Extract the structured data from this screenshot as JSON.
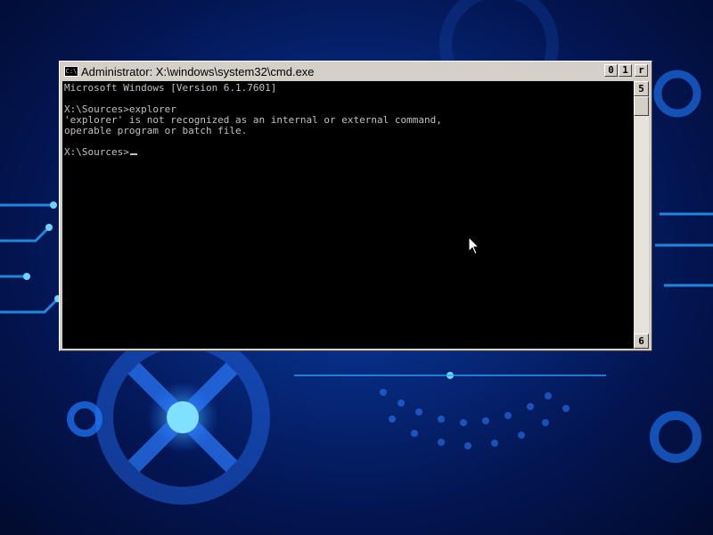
{
  "window": {
    "title": "Administrator: X:\\windows\\system32\\cmd.exe",
    "icon": "cmd-icon",
    "icon_text": "C:\\",
    "buttons": {
      "minimize": "0",
      "maximize": "1",
      "close": "r"
    }
  },
  "console": {
    "text": "Microsoft Windows [Version 6.1.7601]\n\nX:\\Sources>explorer\n'explorer' is not recognized as an internal or external command,\noperable program or batch file.\n\nX:\\Sources>"
  },
  "scrollbar": {
    "up": "5",
    "down": "6"
  },
  "colors": {
    "console_bg": "#000000",
    "console_fg": "#c0c0c0",
    "chrome": "#d4d0c8",
    "desktop_accent": "#1e90ff"
  }
}
